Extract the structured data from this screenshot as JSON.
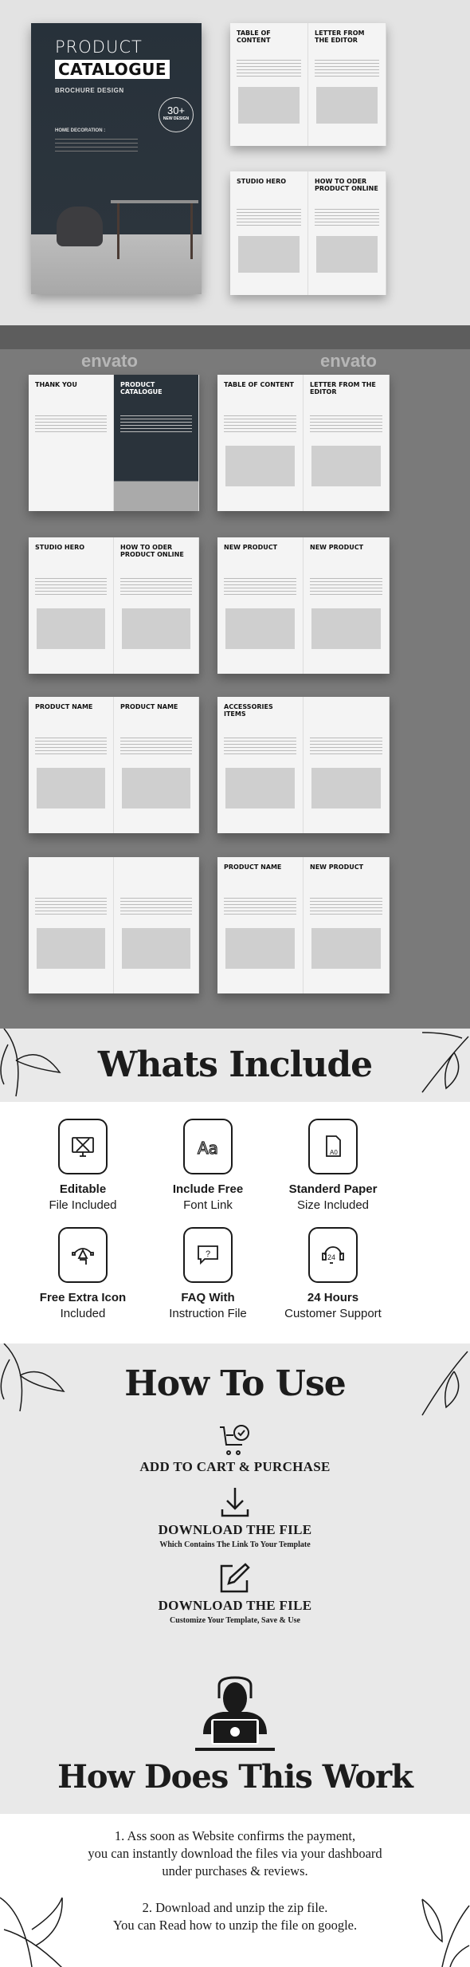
{
  "cover": {
    "title_line1": "PRODUCT",
    "title_line2": "CATALOGUE",
    "subtitle": "BROCHURE DESIGN",
    "badge_number": "30+",
    "badge_label": "NEW DESIGN",
    "section_label": "HOME DECORATION :"
  },
  "preview_spreads": {
    "top": [
      {
        "left": "TABLE OF CONTENT",
        "right": "LETTER FROM THE EDITOR"
      },
      {
        "left": "STUDIO HERO",
        "right": "HOW TO ODER PRODUCT ONLINE"
      }
    ],
    "grid": [
      {
        "left": "THANK YOU",
        "right": "PRODUCT CATALOGUE"
      },
      {
        "left": "TABLE OF CONTENT",
        "right": "LETTER FROM THE EDITOR"
      },
      {
        "left": "STUDIO HERO",
        "right": "HOW TO ODER PRODUCT ONLINE"
      },
      {
        "left": "NEW PRODUCT",
        "right": "NEW PRODUCT"
      },
      {
        "left": "PRODUCT NAME",
        "right": "PRODUCT NAME"
      },
      {
        "left": "ACCESSORIES ITEMS",
        "right": ""
      },
      {
        "left": "",
        "right": ""
      },
      {
        "left": "PRODUCT NAME",
        "right": "NEW PRODUCT"
      }
    ],
    "watermark": "envato"
  },
  "whats_include": {
    "title": "Whats Include",
    "items": [
      {
        "icon": "design-monitor-icon",
        "title": "Editable",
        "subtitle": "File Included"
      },
      {
        "icon": "font-icon",
        "title": "Include Free",
        "subtitle": "Font Link"
      },
      {
        "icon": "paper-size-icon",
        "title": "Standerd Paper",
        "subtitle": "Size Included"
      },
      {
        "icon": "pen-tool-icon",
        "title": "Free Extra Icon",
        "subtitle": "Included"
      },
      {
        "icon": "faq-chat-icon",
        "title": "FAQ With",
        "subtitle": "Instruction File"
      },
      {
        "icon": "support-24-icon",
        "title": "24 Hours",
        "subtitle": "Customer Support"
      }
    ]
  },
  "how_to_use": {
    "title": "How To Use",
    "steps": [
      {
        "icon": "cart-check-icon",
        "title": "ADD TO CART & PURCHASE",
        "subtitle": ""
      },
      {
        "icon": "download-icon",
        "title": "DOWNLOAD THE FILE",
        "subtitle": "Which Contains The Link To Your Template"
      },
      {
        "icon": "edit-icon",
        "title": "DOWNLOAD THE FILE",
        "subtitle": "Customize Your Template, Save & Use"
      }
    ]
  },
  "how_does_this_work": {
    "title": "How Does This Work",
    "p1": [
      "1. Ass soon as Website confirms the payment,",
      "you can instantly download the files via your dashboard",
      "under purchases & reviews."
    ],
    "p2": [
      "2. Download and unzip the zip file.",
      "You can Read how to unzip the file on google."
    ]
  }
}
